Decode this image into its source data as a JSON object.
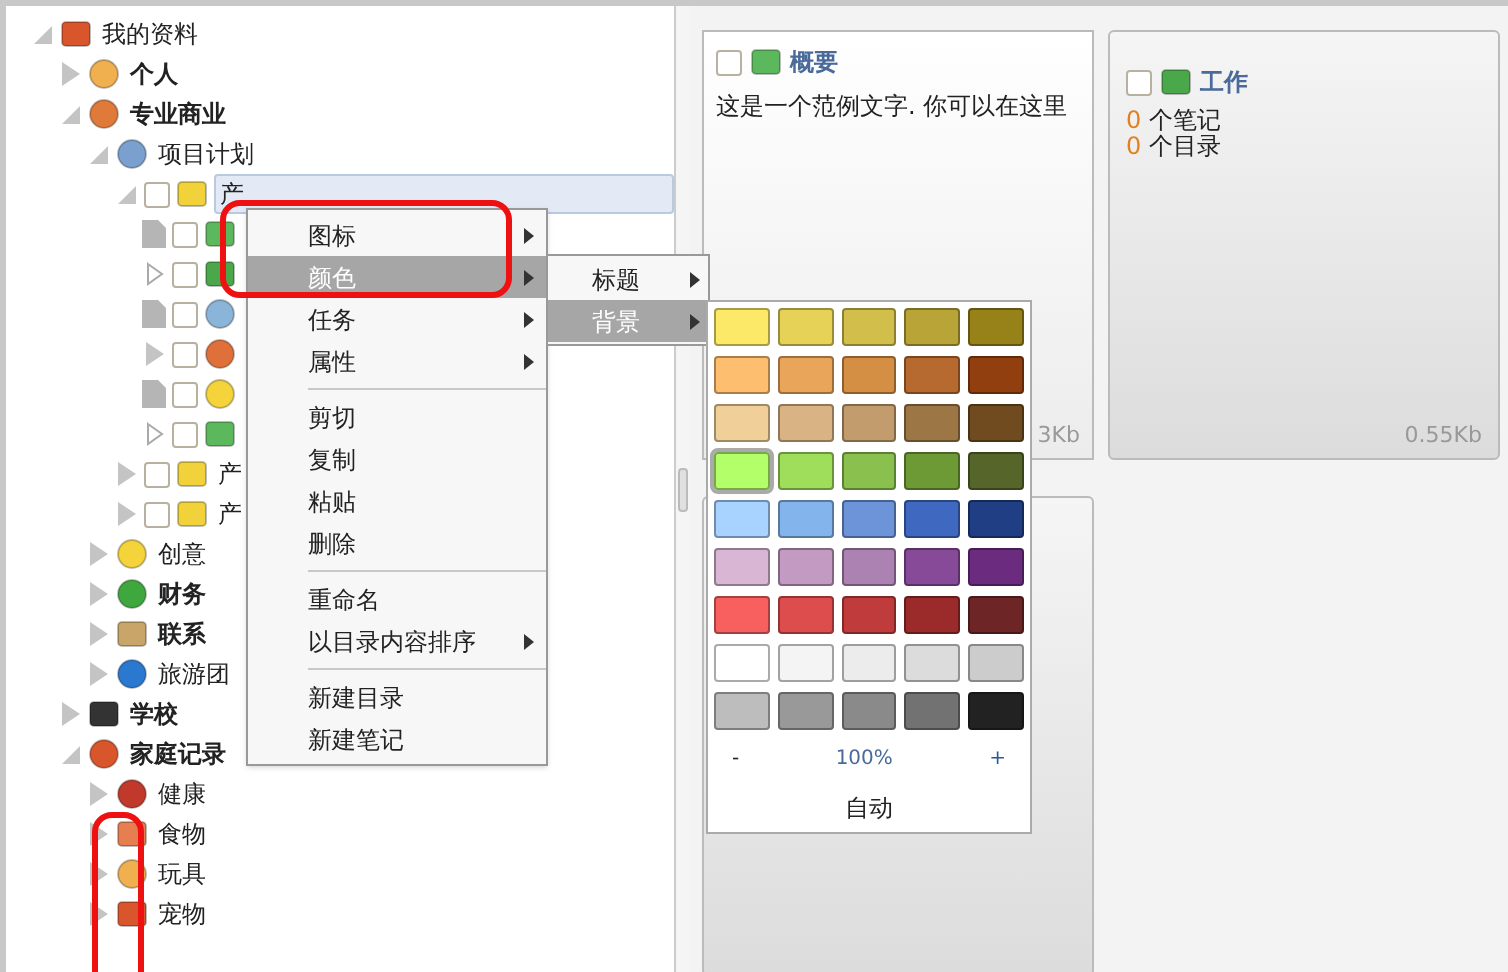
{
  "tree": [
    {
      "label": "我的资料",
      "bold": false,
      "expanded": true,
      "children": [
        {
          "label": "个人",
          "bold": true,
          "expanded": false
        },
        {
          "label": "专业商业",
          "bold": true,
          "expanded": true,
          "children": [
            {
              "label": "项目计划",
              "bold": false,
              "expanded": true,
              "children": [
                {
                  "label": "产",
                  "bold": false,
                  "expanded": true,
                  "checked": false,
                  "selected": true,
                  "children": [
                    {
                      "kind": "note",
                      "checked": false
                    },
                    {
                      "kind": "empty_folder",
                      "checked": false
                    },
                    {
                      "kind": "note",
                      "checked": false
                    },
                    {
                      "kind": "folder",
                      "expanded": false,
                      "checked": false
                    },
                    {
                      "kind": "note",
                      "checked": false
                    },
                    {
                      "kind": "empty_folder",
                      "checked": false
                    }
                  ]
                },
                {
                  "label": "产",
                  "bold": false,
                  "expanded": false,
                  "checked": false,
                  "selected": false
                },
                {
                  "label": "产",
                  "bold": false,
                  "expanded": false,
                  "checked": false,
                  "selected": false
                }
              ]
            },
            {
              "label": "创意",
              "bold": false,
              "expanded": false
            },
            {
              "label": "财务",
              "bold": true,
              "expanded": false
            },
            {
              "label": "联系",
              "bold": true,
              "expanded": false
            },
            {
              "label": "旅游团",
              "bold": false,
              "expanded": false
            }
          ]
        },
        {
          "label": "学校",
          "bold": true,
          "expanded": false
        },
        {
          "label": "家庭记录",
          "bold": true,
          "expanded": true,
          "children": [
            {
              "label": "健康",
              "bold": false,
              "expanded": false
            },
            {
              "label": "食物",
              "bold": false,
              "expanded": false
            },
            {
              "label": "玩具",
              "bold": false,
              "expanded": false
            },
            {
              "label": "宠物",
              "bold": false,
              "expanded": false
            }
          ]
        }
      ]
    }
  ],
  "context_menu": [
    {
      "kind": "item",
      "label": "图标",
      "submenu": true,
      "selected": false
    },
    {
      "kind": "item",
      "label": "颜色",
      "submenu": true,
      "selected": true
    },
    {
      "kind": "item",
      "label": "任务",
      "submenu": true,
      "selected": false
    },
    {
      "kind": "item",
      "label": "属性",
      "submenu": true,
      "selected": false
    },
    {
      "kind": "separator"
    },
    {
      "kind": "item",
      "label": "剪切",
      "submenu": false,
      "selected": false
    },
    {
      "kind": "item",
      "label": "复制",
      "submenu": false,
      "selected": false
    },
    {
      "kind": "item",
      "label": "粘贴",
      "submenu": false,
      "selected": false
    },
    {
      "kind": "item",
      "label": "删除",
      "submenu": false,
      "selected": false
    },
    {
      "kind": "separator"
    },
    {
      "kind": "item",
      "label": "重命名",
      "submenu": false,
      "selected": false
    },
    {
      "kind": "item",
      "label": "以目录内容排序",
      "submenu": true,
      "selected": false
    },
    {
      "kind": "separator"
    },
    {
      "kind": "item",
      "label": "新建目录",
      "submenu": false,
      "selected": false
    },
    {
      "kind": "item",
      "label": "新建笔记",
      "submenu": false,
      "selected": false
    }
  ],
  "color_submenu": [
    {
      "label": "标题",
      "selected": false
    },
    {
      "label": "背景",
      "selected": true
    }
  ],
  "palette": {
    "swatches": [
      {
        "color": "#fde968",
        "selected": false
      },
      {
        "color": "#e6d257",
        "selected": false
      },
      {
        "color": "#d2bf4b",
        "selected": false
      },
      {
        "color": "#b9a437",
        "selected": false
      },
      {
        "color": "#968219",
        "selected": false
      },
      {
        "color": "#fdbf6f",
        "selected": false
      },
      {
        "color": "#e9a55a",
        "selected": false
      },
      {
        "color": "#d58f45",
        "selected": false
      },
      {
        "color": "#b76a2f",
        "selected": false
      },
      {
        "color": "#923f0f",
        "selected": false
      },
      {
        "color": "#f0cf98",
        "selected": false
      },
      {
        "color": "#d9b383",
        "selected": false
      },
      {
        "color": "#c29c6c",
        "selected": false
      },
      {
        "color": "#9c7645",
        "selected": false
      },
      {
        "color": "#6f4b1f",
        "selected": false
      },
      {
        "color": "#b3ff6a",
        "selected": true
      },
      {
        "color": "#9fde5a",
        "selected": false
      },
      {
        "color": "#8ac04d",
        "selected": false
      },
      {
        "color": "#6e9a36",
        "selected": false
      },
      {
        "color": "#56652a",
        "selected": false
      },
      {
        "color": "#a8d2ff",
        "selected": false
      },
      {
        "color": "#84b4ec",
        "selected": false
      },
      {
        "color": "#6d94d9",
        "selected": false
      },
      {
        "color": "#3f68c1",
        "selected": false
      },
      {
        "color": "#1f3e84",
        "selected": false
      },
      {
        "color": "#d8b6d4",
        "selected": false
      },
      {
        "color": "#c39ac2",
        "selected": false
      },
      {
        "color": "#ac82b2",
        "selected": false
      },
      {
        "color": "#874a98",
        "selected": false
      },
      {
        "color": "#6b2c80",
        "selected": false
      },
      {
        "color": "#f86060",
        "selected": false
      },
      {
        "color": "#dd4d4d",
        "selected": false
      },
      {
        "color": "#c03b3b",
        "selected": false
      },
      {
        "color": "#9b2a2a",
        "selected": false
      },
      {
        "color": "#6e2525",
        "selected": false
      },
      {
        "color": "#ffffff",
        "selected": false
      },
      {
        "color": "#f4f4f4",
        "selected": false
      },
      {
        "color": "#ececec",
        "selected": false
      },
      {
        "color": "#dcdcdc",
        "selected": false
      },
      {
        "color": "#cccccc",
        "selected": false
      },
      {
        "color": "#bdbdbd",
        "selected": false
      },
      {
        "color": "#999999",
        "selected": false
      },
      {
        "color": "#8a8a8a",
        "selected": false
      },
      {
        "color": "#727272",
        "selected": false
      },
      {
        "color": "#222222",
        "selected": false
      }
    ],
    "minus": "-",
    "opacity": "100%",
    "plus": "+",
    "auto": "自动"
  },
  "cards": [
    {
      "kind": "note",
      "title": "概要",
      "checked": false,
      "text": "这是一个范例文字. 你可以在这里",
      "size": "3Kb"
    },
    {
      "kind": "folder",
      "title": "工作",
      "checked": false,
      "counts": [
        {
          "count": "0",
          "label": "个笔记"
        },
        {
          "count": "0",
          "label": "个目录"
        }
      ],
      "size": "0.55Kb"
    },
    {
      "kind": "hidden"
    }
  ]
}
